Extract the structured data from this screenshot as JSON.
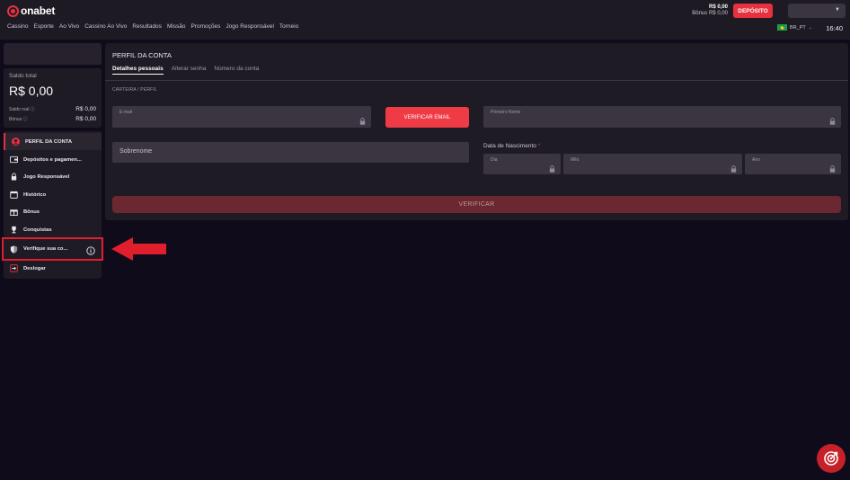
{
  "brand": {
    "logo_text": "onabet",
    "accent": "#e8313f"
  },
  "header": {
    "nav": [
      "Cassino",
      "Esporte",
      "Ao Vivo",
      "Cassino Ao Vivo",
      "Resultados",
      "Missão",
      "Promoções",
      "Jogo Responsável",
      "Torneio"
    ],
    "balance_amount": "R$ 0,00",
    "bonus_amount": "Bônus R$ 0,00",
    "deposit_label": "DEPÓSITO",
    "language_label": "BR_PT",
    "time": "16:40"
  },
  "sidebar": {
    "balance": {
      "label": "Saldo total",
      "value": "R$ 0,00",
      "rows": [
        {
          "label": "Saldo real ⓘ",
          "value": "R$ 0,00"
        },
        {
          "label": "Bônus ⓘ",
          "value": "R$ 0,00"
        }
      ]
    },
    "items": [
      {
        "label": "PERFIL DA CONTA",
        "icon": "user-icon"
      },
      {
        "label": "Depósitos e pagamen...",
        "icon": "wallet-icon"
      },
      {
        "label": "Jogo Responsável",
        "icon": "lock-icon"
      },
      {
        "label": "Histórico",
        "icon": "calendar-icon"
      },
      {
        "label": "Bônus",
        "icon": "gift-icon"
      },
      {
        "label": "Conquistas",
        "icon": "trophy-icon"
      },
      {
        "label": "Verifique sua co...",
        "icon": "shield-icon"
      },
      {
        "label": "Deslogar",
        "icon": "logout-icon"
      }
    ]
  },
  "profile": {
    "title": "PERFIL DA CONTA",
    "tabs": [
      "Detalhes pessoais",
      "Alterar senha",
      "Número da conta"
    ],
    "breadcrumb": "CARTEIRA / PERFIL",
    "email_placeholder": "E-mail",
    "verify_email_label": "VERIFICAR EMAIL",
    "first_name_placeholder": "Primeiro Nome",
    "last_name_placeholder": "Sobrenome",
    "dob_label": "Data de Nascimento",
    "dob_required": "*",
    "day_placeholder": "Dia",
    "month_placeholder": "Mês",
    "year_placeholder": "Ano",
    "verify_label": "VERIFICAR"
  }
}
